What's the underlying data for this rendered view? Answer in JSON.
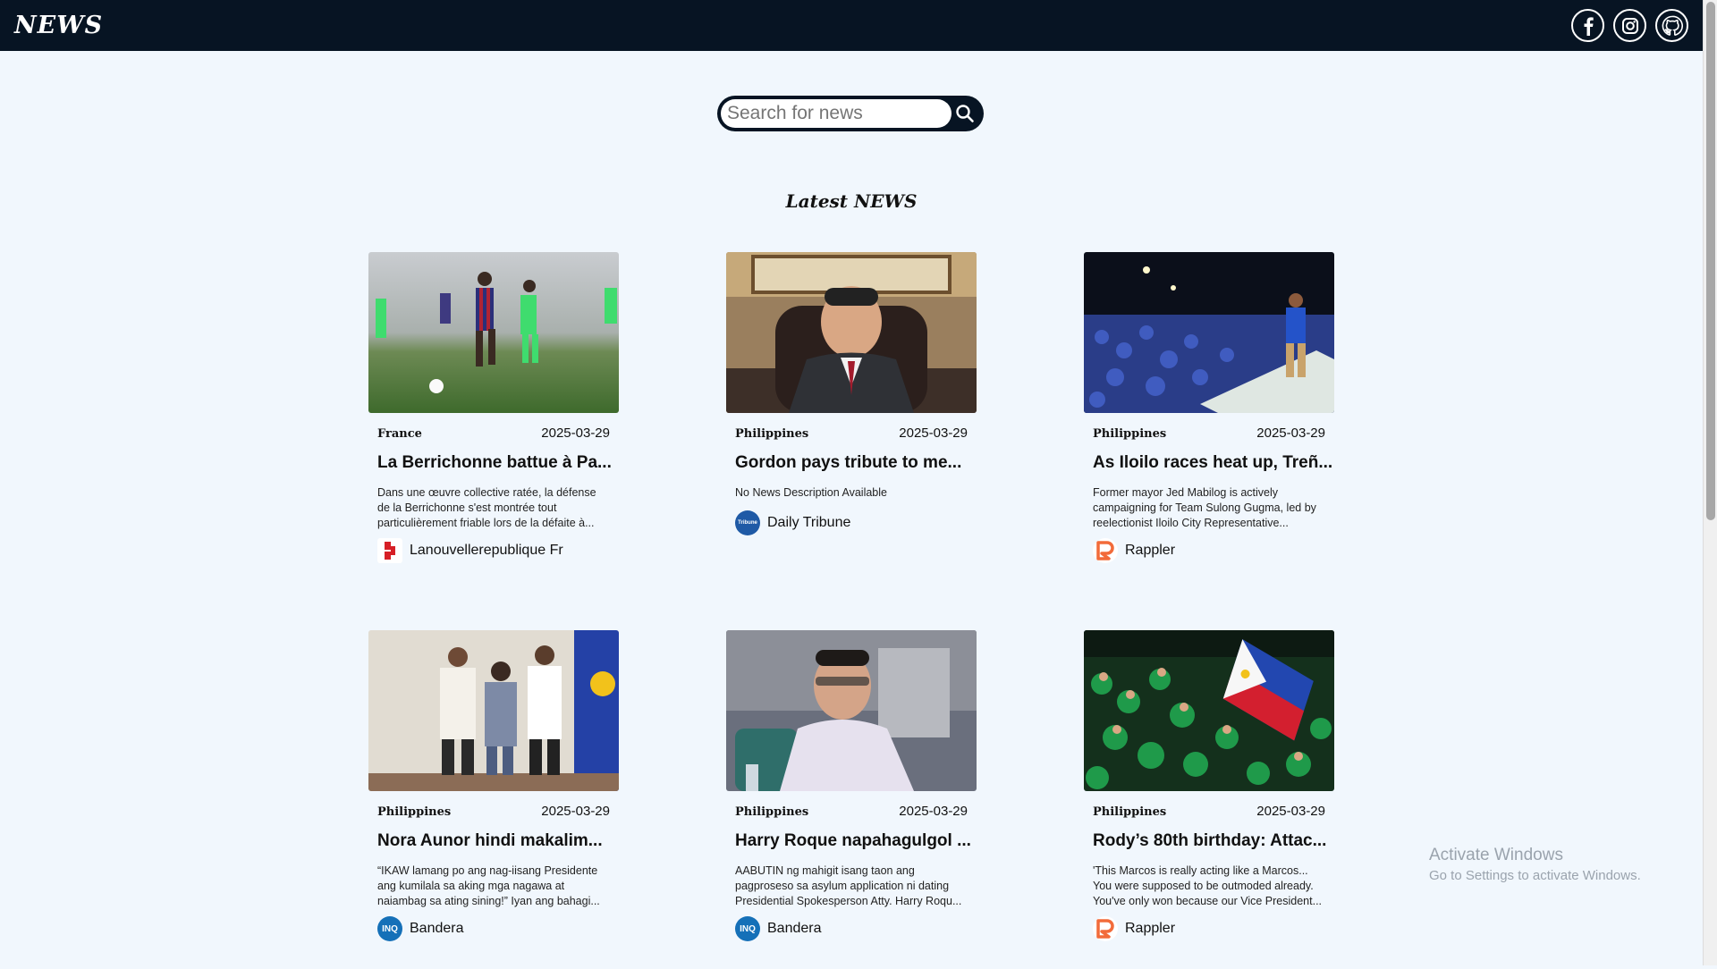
{
  "header": {
    "logo": "NEWS",
    "social": [
      {
        "icon": "facebook-icon",
        "glyph": "f"
      },
      {
        "icon": "instagram-icon",
        "glyph": "◎"
      },
      {
        "icon": "github-icon",
        "glyph": "⌘"
      }
    ]
  },
  "search": {
    "placeholder": "Search for news",
    "value": ""
  },
  "section_title": "Latest NEWS",
  "cards": [
    {
      "country": "France",
      "date": "2025-03-29",
      "title": "La Berrichonne battue à Pa...",
      "description": "Dans une œuvre collective ratée, la défense de la Berrichonne s'est montrée tout particulièrement friable lors de la défaite à...",
      "source": "Lanouvellerepublique Fr",
      "source_color": "#d61f26"
    },
    {
      "country": "Philippines",
      "date": "2025-03-29",
      "title": "Gordon pays tribute to me...",
      "description": "No News Description Available",
      "source": "Daily Tribune",
      "source_color": "#1f5aa6"
    },
    {
      "country": "Philippines",
      "date": "2025-03-29",
      "title": "As Iloilo races heat up, Treñ...",
      "description": "Former mayor Jed Mabilog is actively campaigning for Team Sulong Gugma, led by reelectionist Iloilo City Representative...",
      "source": "Rappler",
      "source_color": "#f26b3a"
    },
    {
      "country": "Philippines",
      "date": "2025-03-29",
      "title": "Nora Aunor hindi makalim...",
      "description": "“IKAW lamang po ang nag-iisang Presidente ang kumilala sa aking mga nagawa at naiambag sa ating sining!” Iyan ang bahagi...",
      "source": "Bandera",
      "source_color": "#1570b8"
    },
    {
      "country": "Philippines",
      "date": "2025-03-29",
      "title": "Harry Roque napahagulgol ...",
      "description": "AABUTIN ng mahigit isang taon ang pagproseso sa asylum application ni dating Presidential Spokesperson Atty. Harry Roqu...",
      "source": "Bandera",
      "source_color": "#1570b8"
    },
    {
      "country": "Philippines",
      "date": "2025-03-29",
      "title": "Rody’s 80th birthday: Attac...",
      "description": "'This Marcos is really acting like a Marcos... You were supposed to be outmoded already. You've only won because our Vice President...",
      "source": "Rappler",
      "source_color": "#f26b3a"
    }
  ],
  "watermark": {
    "line1": "Activate Windows",
    "line2": "Go to Settings to activate Windows."
  }
}
